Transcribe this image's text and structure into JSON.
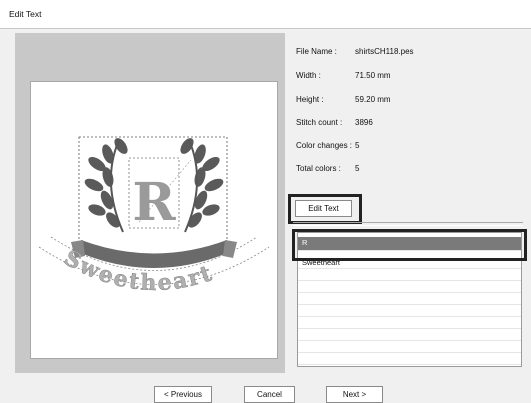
{
  "window": {
    "title": "Edit Text"
  },
  "info": {
    "file_name_label": "File Name :",
    "file_name_value": "shirtsCH118.pes",
    "width_label": "Width :",
    "width_value": "71.50  mm",
    "height_label": "Height :",
    "height_value": "59.20  mm",
    "stitch_label": "Stitch count :",
    "stitch_value": "3896",
    "color_changes_label": "Color changes :",
    "color_changes_value": "5",
    "total_colors_label": "Total colors :",
    "total_colors_value": "5"
  },
  "edit_text_button": "Edit Text",
  "text_list": {
    "items": [
      "R",
      "Sweetheart"
    ],
    "selected_index": 0
  },
  "preview": {
    "monogram": "R",
    "banner_text": "Sweetheart"
  },
  "footer": {
    "previous": "< Previous",
    "cancel": "Cancel",
    "next": "Next >"
  }
}
